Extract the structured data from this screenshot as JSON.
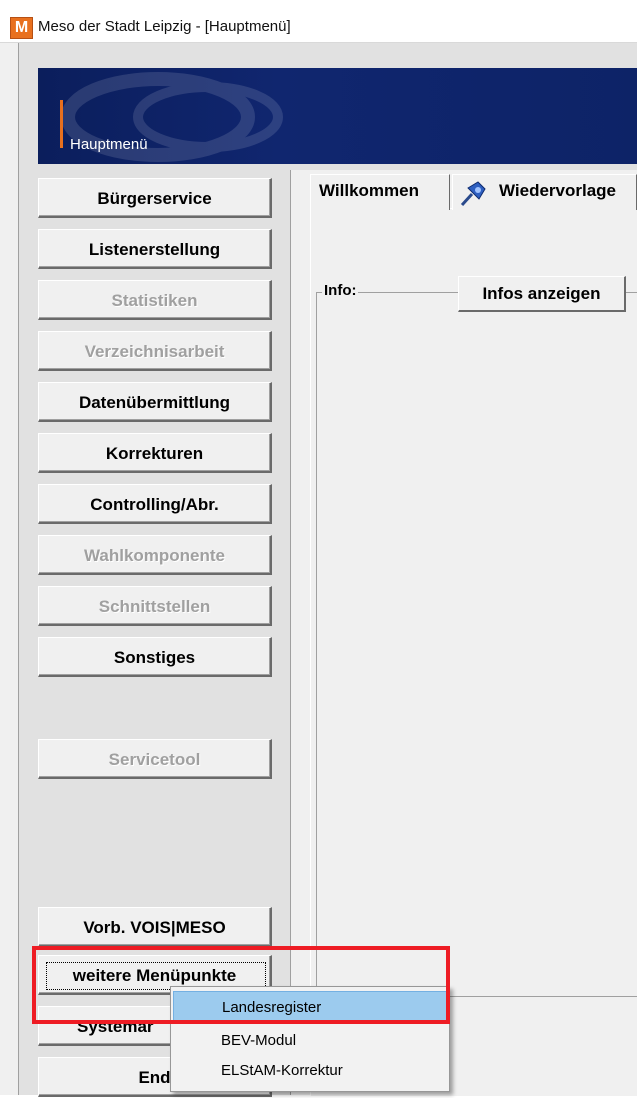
{
  "window": {
    "title": "Meso der Stadt Leipzig - [Hauptmenü]",
    "icon_letter": "M"
  },
  "banner": {
    "label": "Hauptmenü"
  },
  "nav": {
    "buergerservice": "Bürgerservice",
    "listenerstellung": "Listenerstellung",
    "statistiken": "Statistiken",
    "verzeichnisarbeit": "Verzeichnisarbeit",
    "datenuebermittlung": "Datenübermittlung",
    "korrekturen": "Korrekturen",
    "controlling": "Controlling/Abr.",
    "wahlkomponente": "Wahlkomponente",
    "schnittstellen": "Schnittstellen",
    "sonstiges": "Sonstiges",
    "servicetool": "Servicetool",
    "vorb": "Vorb. VOIS|MESO",
    "weitere": "weitere Menüpunkte",
    "system": "Systemar",
    "ende": "End"
  },
  "tabs": {
    "willkommen": "Willkommen",
    "wiedervorlage": "Wiedervorlage"
  },
  "info": {
    "group_label": "Info:",
    "button": "Infos anzeigen"
  },
  "context_menu": {
    "items": [
      "Landesregister",
      "BEV-Modul",
      "ELStAM-Korrektur"
    ],
    "highlighted": "Landesregister"
  },
  "colors": {
    "banner": "#10266f",
    "accent": "#e8701e",
    "highlight": "#9ccbee",
    "annotation": "#ee1c24"
  },
  "icons": {
    "app": "meso-logo-icon",
    "tab": "pin-icon"
  }
}
